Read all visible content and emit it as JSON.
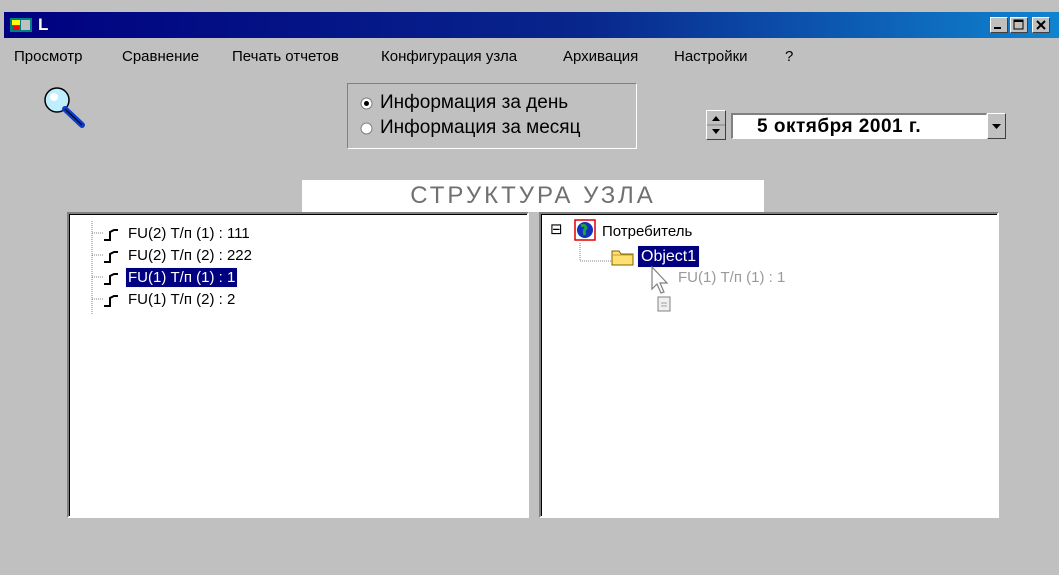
{
  "window": {
    "title": "L",
    "colors": {
      "titlebar": "#000080",
      "face": "#c0c0c0",
      "selection": "#000080"
    }
  },
  "menu": {
    "items": [
      "Просмотр",
      "Сравнение",
      "Печать отчетов",
      "Конфигурация узла",
      "Архивация",
      "Настройки",
      "?"
    ]
  },
  "mode": {
    "options": [
      {
        "label": "Информация за день",
        "checked": true
      },
      {
        "label": "Информация за месяц",
        "checked": false
      }
    ]
  },
  "date": {
    "value": "5  октября  2001 г."
  },
  "structure": {
    "title": "СТРУКТУРА УЗЛА"
  },
  "left_tree": {
    "items": [
      {
        "label": "FU(2) Т/п (1) : 111",
        "selected": false
      },
      {
        "label": "FU(2) Т/п (2) : 222",
        "selected": false
      },
      {
        "label": "FU(1) Т/п (1) : 1",
        "selected": true
      },
      {
        "label": "FU(1) Т/п (2) : 2",
        "selected": false
      }
    ]
  },
  "right_tree": {
    "root": {
      "label": "Потребитель",
      "expand_glyph": "⊟"
    },
    "child": {
      "label": "Object1",
      "selected": true
    },
    "drag_ghost": {
      "label": "FU(1) Т/п (1) : 1"
    }
  },
  "icons": {
    "app": "app-icon",
    "search": "search-icon",
    "sensor": "sensor-icon",
    "globe": "globe-icon",
    "folder": "folder-icon",
    "cursor": "drag-cursor-icon"
  }
}
